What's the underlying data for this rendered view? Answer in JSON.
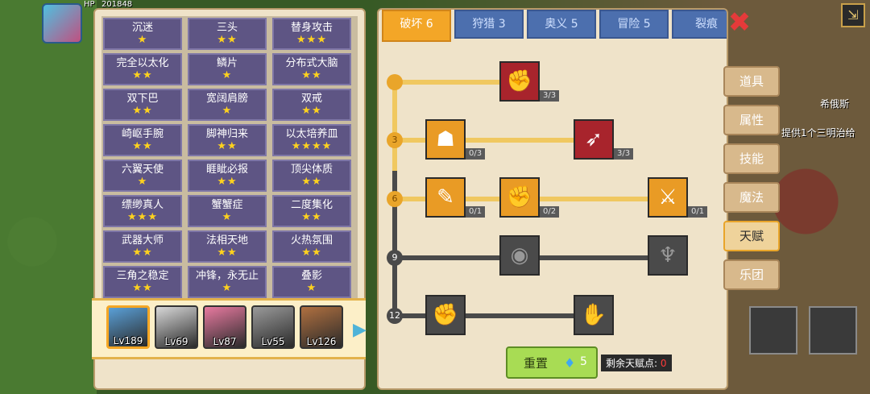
{
  "world": {
    "player_hp_label": "HP",
    "player_hp_value": "201848",
    "npc_name": "希俄斯",
    "npc_hint": "提供1个三明治给"
  },
  "traits": [
    {
      "name": "沉迷",
      "stars": "★"
    },
    {
      "name": "三头",
      "stars": "★★"
    },
    {
      "name": "替身攻击",
      "stars": "★★★"
    },
    {
      "name": "完全以太化",
      "stars": "★★"
    },
    {
      "name": "鳞片",
      "stars": "★"
    },
    {
      "name": "分布式大脑",
      "stars": "★★"
    },
    {
      "name": "双下巴",
      "stars": "★★"
    },
    {
      "name": "宽阔肩膀",
      "stars": "★"
    },
    {
      "name": "双戒",
      "stars": "★★"
    },
    {
      "name": "崎岖手腕",
      "stars": "★★"
    },
    {
      "name": "脚神归来",
      "stars": "★★"
    },
    {
      "name": "以太培养皿",
      "stars": "★★★★"
    },
    {
      "name": "六翼天使",
      "stars": "★"
    },
    {
      "name": "睚眦必报",
      "stars": "★★"
    },
    {
      "name": "顶尖体质",
      "stars": "★★"
    },
    {
      "name": "缥缈真人",
      "stars": "★★★"
    },
    {
      "name": "蟹蟹症",
      "stars": "★"
    },
    {
      "name": "二度集化",
      "stars": "★★"
    },
    {
      "name": "武器大师",
      "stars": "★★"
    },
    {
      "name": "法相天地",
      "stars": "★★"
    },
    {
      "name": "火热氛围",
      "stars": "★★"
    },
    {
      "name": "三角之稳定",
      "stars": "★★"
    },
    {
      "name": "冲锋，永无止",
      "stars": "★"
    },
    {
      "name": "叠影",
      "stars": "★"
    }
  ],
  "heroes": [
    {
      "level": "Lv189",
      "color": "#5aa0d8",
      "selected": true
    },
    {
      "level": "Lv69",
      "color": "#d8d8d8",
      "selected": false
    },
    {
      "level": "Lv87",
      "color": "#e87aa0",
      "selected": false
    },
    {
      "level": "Lv55",
      "color": "#9a9a9a",
      "selected": false
    },
    {
      "level": "Lv126",
      "color": "#b07040",
      "selected": false
    }
  ],
  "tabs": [
    {
      "label": "破坏 6",
      "active": true
    },
    {
      "label": "狩猎 3",
      "active": false
    },
    {
      "label": "奥义 5",
      "active": false
    },
    {
      "label": "冒险 5",
      "active": false
    },
    {
      "label": "裂痕",
      "active": false
    }
  ],
  "tiers": [
    "3",
    "6",
    "9",
    "12"
  ],
  "nodes": [
    {
      "name": "arm-wrestle-talent",
      "icon": "✊",
      "count": "3/3",
      "style": "red"
    },
    {
      "name": "muscle-body-talent",
      "icon": "☗",
      "count": "0/3",
      "style": "orange"
    },
    {
      "name": "blood-arrow-talent",
      "icon": "➶",
      "count": "3/3",
      "style": "red"
    },
    {
      "name": "scroll-talent",
      "icon": "✎",
      "count": "0/1",
      "style": "orange"
    },
    {
      "name": "fist-punch-talent",
      "icon": "✊",
      "count": "0/2",
      "style": "orange"
    },
    {
      "name": "sword-slash-talent",
      "icon": "⚔",
      "count": "0/1",
      "style": "orange"
    },
    {
      "name": "ground-pound-talent",
      "icon": "◉",
      "count": "",
      "style": "locked"
    },
    {
      "name": "bat-wings-talent",
      "icon": "♆",
      "count": "",
      "style": "locked"
    },
    {
      "name": "raised-fist-talent",
      "icon": "✊",
      "count": "",
      "style": "locked"
    },
    {
      "name": "grip-talent",
      "icon": "✋",
      "count": "",
      "style": "locked"
    }
  ],
  "reset": {
    "label": "重置",
    "cost": "5"
  },
  "remaining": {
    "label": "剩余天赋点:",
    "value": "0"
  },
  "side_menu": [
    {
      "label": "道具",
      "active": false
    },
    {
      "label": "属性",
      "active": false
    },
    {
      "label": "技能",
      "active": false
    },
    {
      "label": "魔法",
      "active": false
    },
    {
      "label": "天赋",
      "active": true
    },
    {
      "label": "乐团",
      "active": false
    }
  ],
  "close_icon": "close-icon",
  "colors": {
    "accent": "#f3a627",
    "tab_inactive": "#4c6fae",
    "trait_bg": "#5e5584",
    "star": "#ffd21e"
  }
}
